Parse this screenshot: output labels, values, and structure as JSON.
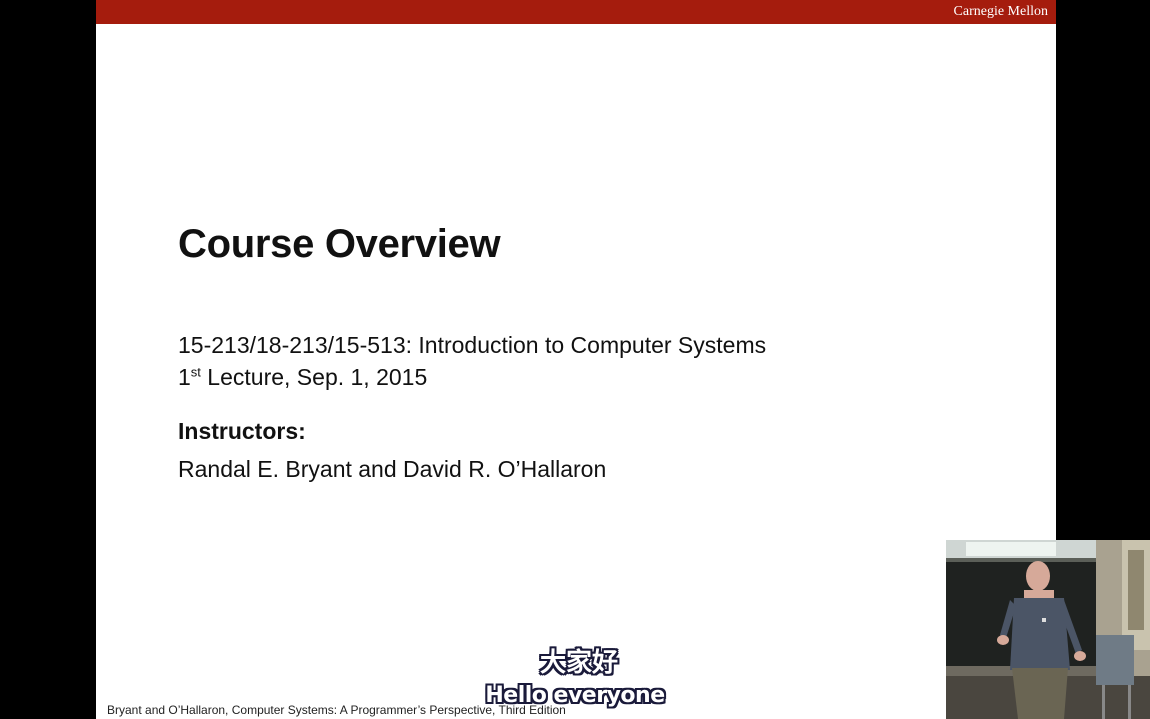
{
  "slide": {
    "brand": "Carnegie Mellon",
    "title": "Course Overview",
    "course": "15-213/18-213/15-513: Introduction to Computer Systems",
    "lecture_prefix": "1",
    "lecture_sup": "st",
    "lecture_rest": " Lecture, Sep. 1, 2015",
    "instructors_label": "Instructors:",
    "instructors_names": "Randal E. Bryant and David R. O’Hallaron",
    "footer": "Bryant and O’Hallaron, Computer Systems: A Programmer’s Perspective, Third Edition"
  },
  "subtitles": {
    "chinese": "大家好",
    "english": "Hello everyone"
  },
  "colors": {
    "header_bar": "#a51c0d",
    "background": "#000000",
    "slide": "#ffffff"
  }
}
